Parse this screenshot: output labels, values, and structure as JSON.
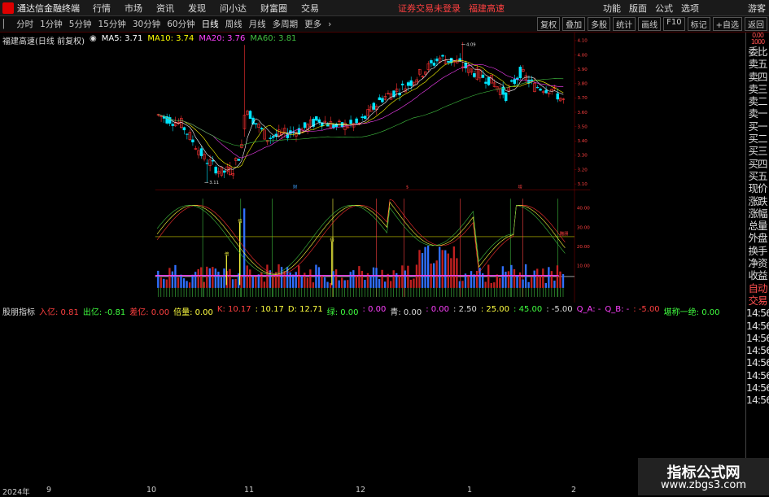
{
  "topbar": {
    "app_name": "通达信金融终端",
    "menus": [
      "行情",
      "市场",
      "资讯",
      "发现",
      "问小达",
      "财富圈",
      "交易"
    ],
    "status": "证券交易未登录",
    "stock_name": "福建高速",
    "right_items": [
      "功能",
      "版面",
      "公式",
      "选项"
    ],
    "guest": "游客"
  },
  "toolbar": {
    "timeframes": [
      "分时",
      "1分钟",
      "5分钟",
      "15分钟",
      "30分钟",
      "60分钟",
      "日线",
      "周线",
      "月线",
      "多周期",
      "更多"
    ],
    "active": "日线",
    "right_buttons": [
      "复权",
      "叠加",
      "多股",
      "统计",
      "画线",
      "F10",
      "标记",
      "+自选",
      "返回"
    ]
  },
  "main_legend": {
    "title": "福建高速(日线 前复权)",
    "ma5": "MA5: 3.71",
    "ma10": "MA10: 3.74",
    "ma20": "MA20: 3.76",
    "ma60": "MA60: 3.81"
  },
  "price_axis": [
    "4.10",
    "4.00",
    "3.90",
    "3.80",
    "3.70",
    "3.60",
    "3.50",
    "3.40",
    "3.30",
    "3.20",
    "3.10"
  ],
  "price_annotations": {
    "high": "4.09",
    "low": "3.11"
  },
  "event_marks": [
    "财",
    "$",
    "增"
  ],
  "indicator_legend": {
    "name": "股朋指标",
    "items": [
      {
        "text": "入亿: 0.81",
        "color": "#ff4040"
      },
      {
        "text": "出亿: -0.81",
        "color": "#40ff40"
      },
      {
        "text": "差亿: 0.00",
        "color": "#ff4040"
      },
      {
        "text": "倍量: 0.00",
        "color": "#ffff40"
      },
      {
        "text": "K: 10.17",
        "color": "#ff4040"
      },
      {
        "text": ": 10.17",
        "color": "#ffff40"
      },
      {
        "text": "D: 12.71",
        "color": "#ffff40"
      },
      {
        "text": "绿: 0.00",
        "color": "#40ff40"
      },
      {
        "text": ": 0.00",
        "color": "#ff40ff"
      },
      {
        "text": "青: 0.00",
        "color": "#ddd"
      },
      {
        "text": ": 0.00",
        "color": "#ff40ff"
      },
      {
        "text": ": 2.50",
        "color": "#ddd"
      },
      {
        "text": ": 25.00",
        "color": "#ffff40"
      },
      {
        "text": ": 45.00",
        "color": "#40ff40"
      },
      {
        "text": ": -5.00",
        "color": "#ddd"
      },
      {
        "text": "Q_A: -",
        "color": "#ff40ff"
      },
      {
        "text": "Q_B: -",
        "color": "#ff40ff"
      },
      {
        "text": ": -5.00",
        "color": "#ff4040"
      },
      {
        "text": "堪称一绝: 0.00",
        "color": "#40ff40"
      }
    ]
  },
  "indicator_axis": [
    "40.00",
    "30.00",
    "20.00",
    "10.00"
  ],
  "indicator_tags": {
    "bei": "倍",
    "reference": "瞄朋"
  },
  "side_panel": [
    "委比",
    "卖五",
    "卖四",
    "卖三",
    "卖二",
    "卖一",
    "买一",
    "买二",
    "买三",
    "买四",
    "买五",
    "现价",
    "涨跌",
    "涨幅",
    "总量",
    "外盘",
    "换手",
    "净资",
    "收益",
    "自动",
    "交易",
    "14:56",
    "14:56",
    "14:56",
    "14:56",
    "14:56",
    "14:56",
    "14:56",
    "14:56"
  ],
  "side_panel_top": "0.00 1000",
  "x_axis": [
    "2024年",
    "9",
    "10",
    "11",
    "12",
    "1",
    "2"
  ],
  "watermark": {
    "title": "指标公式网",
    "url": "www.zbgs3.com"
  },
  "colors": {
    "up": "#ff3232",
    "down": "#00e5ff",
    "ma5": "#ffffff",
    "ma10": "#ffff00",
    "ma20": "#ff40ff",
    "ma60": "#40c040"
  }
}
